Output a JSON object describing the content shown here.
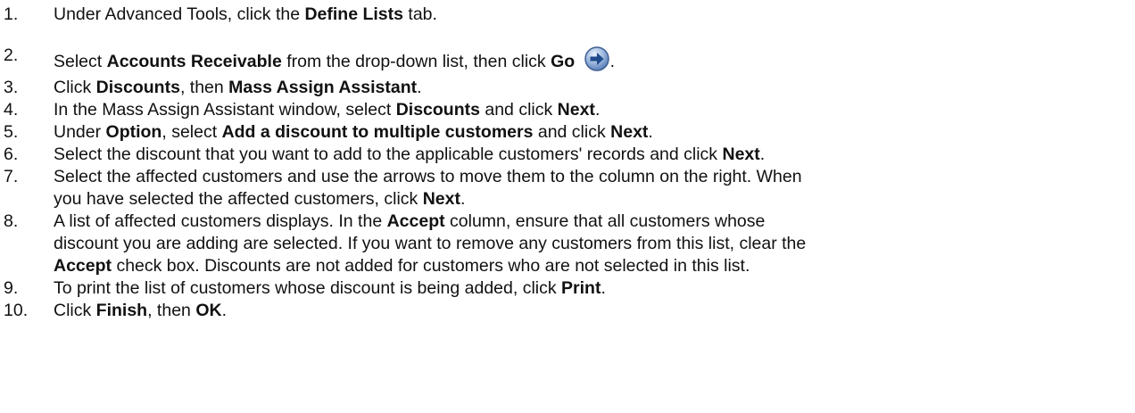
{
  "steps": [
    {
      "num": "1.",
      "parts": [
        {
          "t": "Under Advanced Tools, click the "
        },
        {
          "t": "Define Lists",
          "b": true
        },
        {
          "t": " tab."
        }
      ]
    },
    {
      "num": "2.",
      "icon_after": "go-arrow-icon",
      "parts": [
        {
          "t": "Select "
        },
        {
          "t": "Accounts Receivable",
          "b": true
        },
        {
          "t": " from the drop-down list, then click "
        },
        {
          "t": "Go",
          "b": true
        },
        {
          "t": " "
        },
        {
          "icon": true
        },
        {
          "t": "."
        }
      ]
    },
    {
      "num": "3.",
      "parts": [
        {
          "t": "Click "
        },
        {
          "t": "Discounts",
          "b": true
        },
        {
          "t": ", then "
        },
        {
          "t": "Mass Assign Assistant",
          "b": true
        },
        {
          "t": "."
        }
      ]
    },
    {
      "num": "4.",
      "parts": [
        {
          "t": "In the Mass Assign Assistant window, select "
        },
        {
          "t": "Discounts",
          "b": true
        },
        {
          "t": " and click "
        },
        {
          "t": "Next",
          "b": true
        },
        {
          "t": "."
        }
      ]
    },
    {
      "num": "5.",
      "parts": [
        {
          "t": "Under "
        },
        {
          "t": "Option",
          "b": true
        },
        {
          "t": ", select "
        },
        {
          "t": "Add a discount to multiple customers",
          "b": true
        },
        {
          "t": " and click "
        },
        {
          "t": "Next",
          "b": true
        },
        {
          "t": "."
        }
      ]
    },
    {
      "num": "6.",
      "parts": [
        {
          "t": "Select the discount that you want to add to the applicable customers' records and click "
        },
        {
          "t": "Next",
          "b": true
        },
        {
          "t": "."
        }
      ]
    },
    {
      "num": "7.",
      "lines": [
        [
          {
            "t": "Select the affected customers and use the arrows to move them to the column on the right. When"
          }
        ],
        [
          {
            "t": "you have selected the affected customers, click "
          },
          {
            "t": "Next",
            "b": true
          },
          {
            "t": "."
          }
        ]
      ]
    },
    {
      "num": "8.",
      "lines": [
        [
          {
            "t": "A list of affected customers displays. In the "
          },
          {
            "t": "Accept",
            "b": true
          },
          {
            "t": " column, ensure that all customers whose"
          }
        ],
        [
          {
            "t": "discount you are adding are selected. If you want to remove any customers from this list, clear the"
          }
        ],
        [
          {
            "t": "Accept",
            "b": true
          },
          {
            "t": " check box. Discounts are not added for customers who are not selected in this list."
          }
        ]
      ]
    },
    {
      "num": "9.",
      "parts": [
        {
          "t": "To print the list of customers whose discount is being added, click "
        },
        {
          "t": "Print",
          "b": true
        },
        {
          "t": "."
        }
      ]
    },
    {
      "num": "10.",
      "parts": [
        {
          "t": "Click "
        },
        {
          "t": "Finish",
          "b": true
        },
        {
          "t": ", then "
        },
        {
          "t": "OK",
          "b": true
        },
        {
          "t": "."
        }
      ]
    }
  ]
}
